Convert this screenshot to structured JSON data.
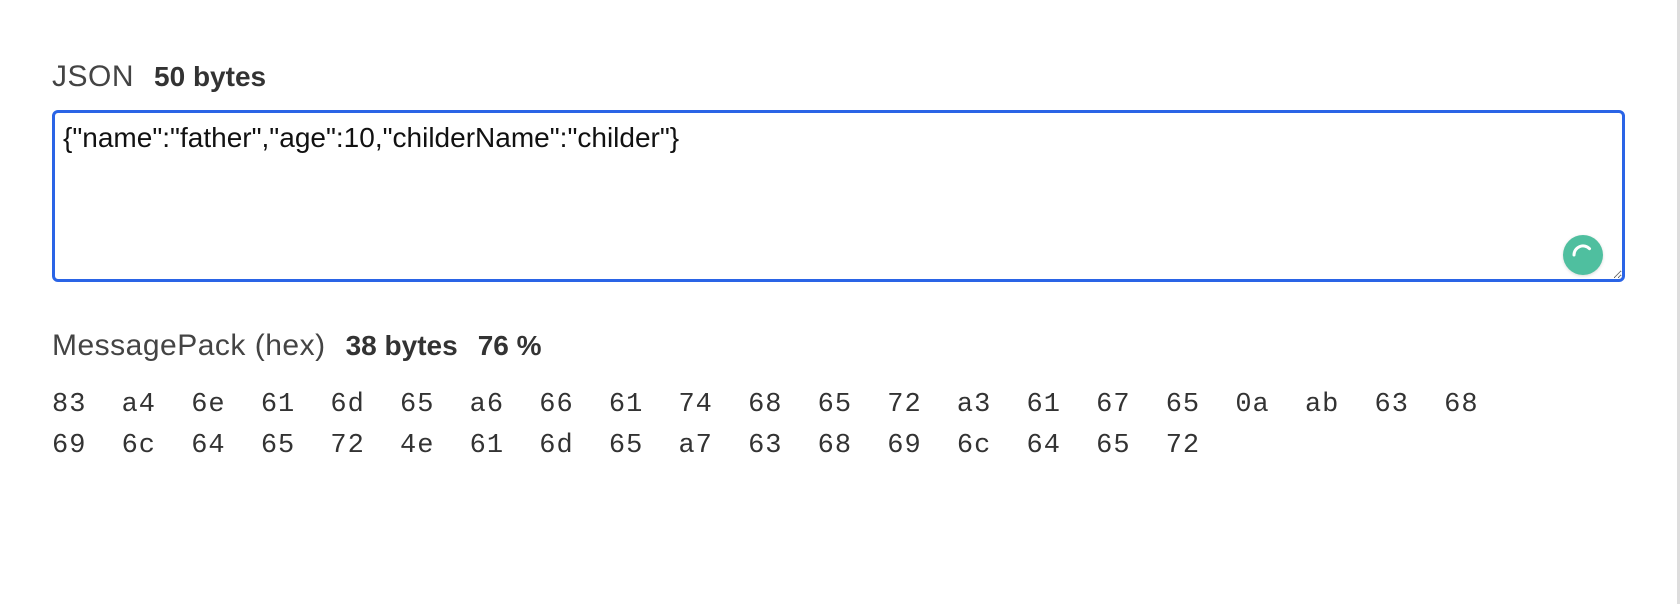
{
  "json_section": {
    "title": "JSON",
    "bytes_label": "50 bytes",
    "textarea_value": "{\"name\":\"father\",\"age\":10,\"childerName\":\"childer\"}"
  },
  "msgpack_section": {
    "title": "MessagePack (hex)",
    "bytes_label": "38 bytes",
    "percent_label": "76 %",
    "hex": "83 a4 6e 61 6d 65 a6 66 61 74 68 65 72 a3 61 67 65 0a ab 63 68 69 6c 64 65 72 4e 61 6d 65 a7 63 68 69 6c 64 65 72"
  },
  "colors": {
    "focus_border": "#2a64e6",
    "badge_bg": "#4fbf9f"
  }
}
